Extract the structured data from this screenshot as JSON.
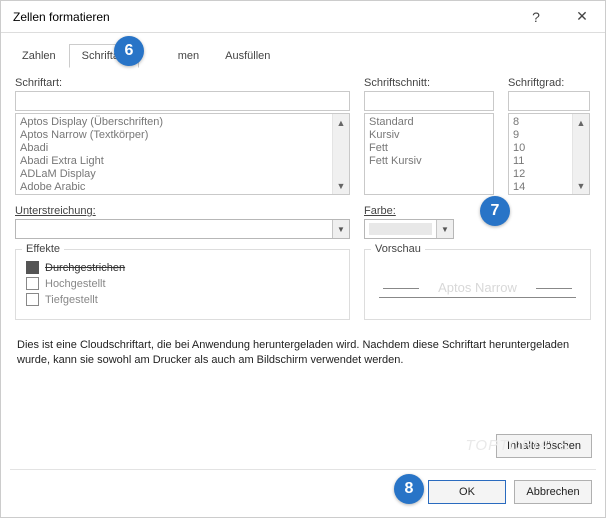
{
  "window": {
    "title": "Zellen formatieren",
    "help": "?",
    "close": "✕"
  },
  "tabs": {
    "t1": "Zahlen",
    "t2": "Schriftart",
    "t3": "Rahmen",
    "t4": "Ausfüllen",
    "active": 1
  },
  "font": {
    "label": "Schriftart:",
    "value": "",
    "items": [
      "Aptos Display (Überschriften)",
      "Aptos Narrow (Textkörper)",
      "Abadi",
      "Abadi Extra Light",
      "ADLaM Display",
      "Adobe Arabic"
    ]
  },
  "style": {
    "label": "Schriftschnitt:",
    "value": "",
    "items": [
      "Standard",
      "Kursiv",
      "Fett",
      "Fett Kursiv"
    ]
  },
  "size": {
    "label": "Schriftgrad:",
    "value": "",
    "items": [
      "8",
      "9",
      "10",
      "11",
      "12",
      "14"
    ]
  },
  "underline": {
    "label": "Unterstreichung:",
    "value": ""
  },
  "color": {
    "label": "Farbe:",
    "value": ""
  },
  "effects": {
    "legend": "Effekte",
    "strike": "Durchgestrichen",
    "super": "Hochgestellt",
    "sub": "Tiefgestellt"
  },
  "preview": {
    "legend": "Vorschau",
    "sample": "Aptos Narrow"
  },
  "note": "Dies ist eine Cloudschriftart, die bei Anwendung heruntergeladen wird. Nachdem diese Schriftart heruntergeladen wurde, kann sie sowohl am Drucker als auch am Bildschirm verwendet werden.",
  "buttons": {
    "clear": "Inhalte löschen",
    "ok": "OK",
    "cancel": "Abbrechen"
  },
  "badges": {
    "b6": "6",
    "b7": "7",
    "b8": "8"
  },
  "watermark": "TOPTORIALS"
}
